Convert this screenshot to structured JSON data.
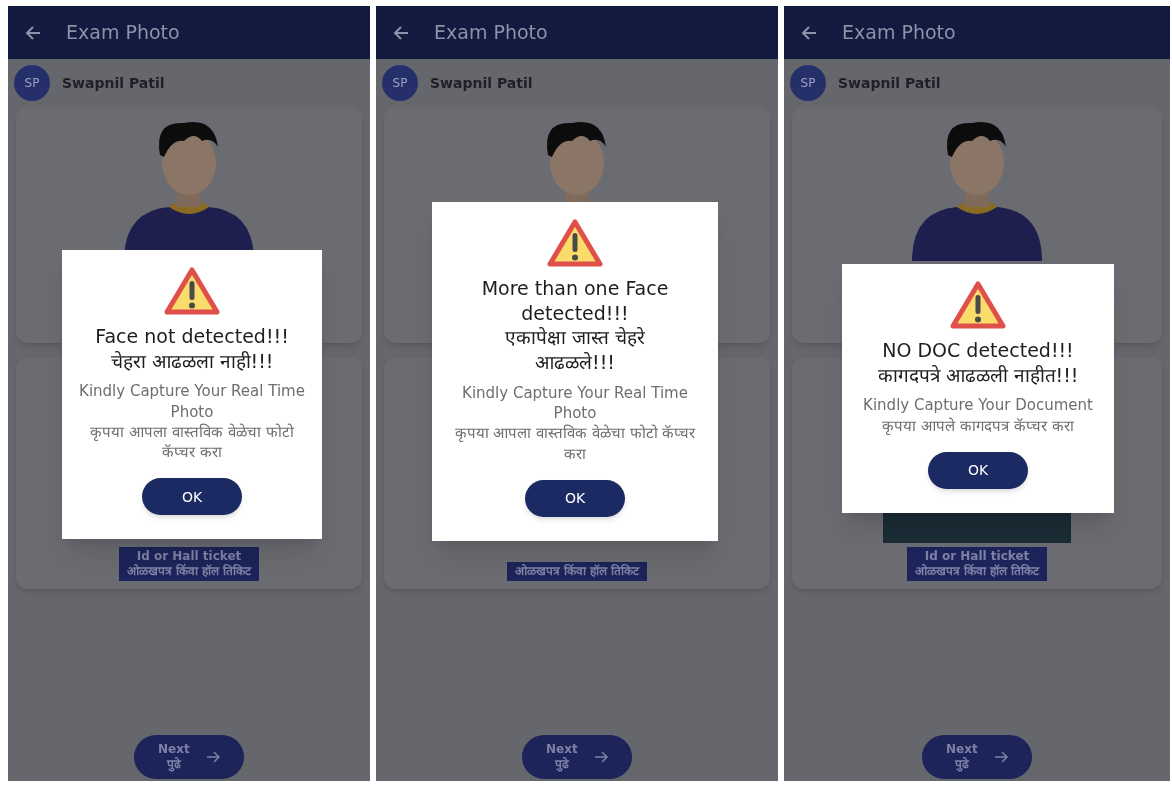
{
  "screens": [
    {
      "header": {
        "title": "Exam Photo"
      },
      "user": {
        "initials": "SP",
        "name": "Swapnil Patil"
      },
      "id_button": {
        "lines": [
          "Id or Hall ticket",
          "ओळखपत्र किंवा हॉल तिकिट"
        ]
      },
      "next_button": {
        "lines": [
          "Next",
          "पुढे"
        ]
      },
      "dialog": {
        "title_lines": [
          "Face not detected!!!",
          "चेहरा आढळला नाही!!!"
        ],
        "message_lines": [
          "Kindly Capture Your Real Time Photo",
          "कृपया आपला वास्तविक वेळेचा फोटो कॅप्चर करा"
        ],
        "ok": "OK"
      }
    },
    {
      "header": {
        "title": "Exam Photo"
      },
      "user": {
        "initials": "SP",
        "name": "Swapnil Patil"
      },
      "id_button": {
        "lines": [
          "ओळखपत्र किंवा हॉल तिकिट"
        ]
      },
      "next_button": {
        "lines": [
          "Next",
          "पुढे"
        ]
      },
      "dialog": {
        "title_lines": [
          "More than one Face detected!!!",
          "एकापेक्षा जास्त चेहरे आढळले!!!"
        ],
        "message_lines": [
          "Kindly Capture Your Real Time Photo",
          "कृपया आपला वास्तविक वेळेचा फोटो कॅप्चर करा"
        ],
        "ok": "OK"
      }
    },
    {
      "header": {
        "title": "Exam Photo"
      },
      "user": {
        "initials": "SP",
        "name": "Swapnil Patil"
      },
      "id_button": {
        "lines": [
          "Id or Hall ticket",
          "ओळखपत्र किंवा हॉल तिकिट"
        ]
      },
      "document_preview": true,
      "next_button": {
        "lines": [
          "Next",
          "पुढे"
        ]
      },
      "dialog": {
        "title_lines": [
          "NO DOC detected!!!",
          "कागदपत्रे आढळली नाहीत!!!"
        ],
        "message_lines": [
          "Kindly Capture Your Document",
          "कृपया आपले कागदपत्र कॅप्चर करा"
        ],
        "ok": "OK"
      }
    }
  ]
}
